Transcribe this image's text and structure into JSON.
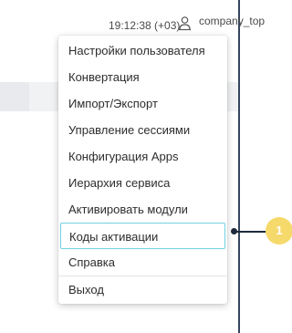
{
  "header": {
    "time": "19:12:38 (+03)",
    "user_icon": "user-icon",
    "company": "company_top"
  },
  "menu": {
    "items": [
      {
        "label": "Настройки пользователя"
      },
      {
        "label": "Конвертация"
      },
      {
        "label": "Импорт/Экспорт"
      },
      {
        "label": "Управление сессиями"
      },
      {
        "label": "Конфигурация Apps"
      },
      {
        "label": "Иерархия сервиса"
      },
      {
        "label": "Активировать модули"
      },
      {
        "label": "Коды активации"
      },
      {
        "label": "Справка"
      },
      {
        "label": "Выход"
      }
    ],
    "highlight_color": "#6fd3e0"
  },
  "callout": {
    "number": "1",
    "color": "#f5d96b"
  }
}
